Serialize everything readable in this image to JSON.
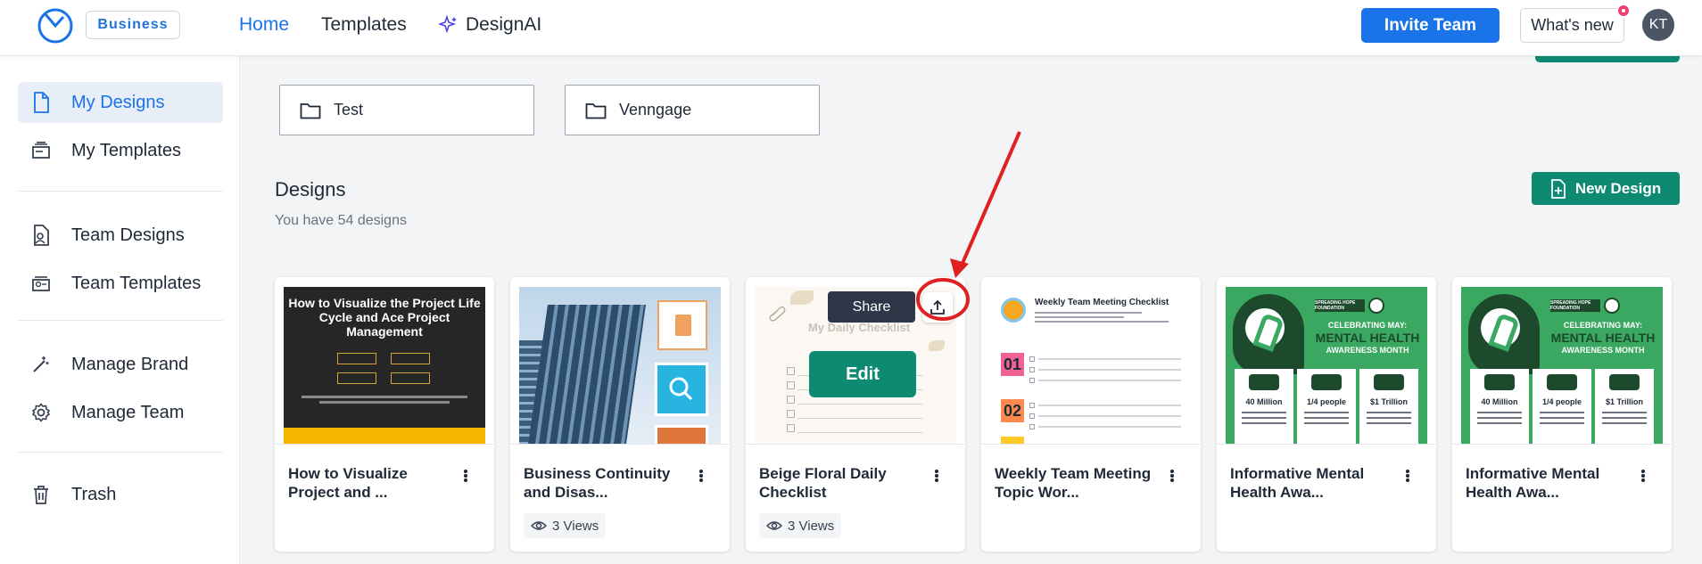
{
  "header": {
    "badge": "Business",
    "nav": [
      {
        "label": "Home"
      },
      {
        "label": "Templates"
      },
      {
        "label": "DesignAI"
      }
    ],
    "invite_label": "Invite Team",
    "whats_new_label": "What's new",
    "avatar_initials": "KT"
  },
  "sidebar": {
    "items": [
      {
        "label": "My Designs",
        "icon": "file-icon"
      },
      {
        "label": "My Templates",
        "icon": "template-icon"
      },
      {
        "label": "Team Designs",
        "icon": "team-file-icon"
      },
      {
        "label": "Team Templates",
        "icon": "team-template-icon"
      },
      {
        "label": "Manage Brand",
        "icon": "magic-wand-icon"
      },
      {
        "label": "Manage Team",
        "icon": "gear-icon"
      },
      {
        "label": "Trash",
        "icon": "trash-icon"
      }
    ]
  },
  "folders": [
    {
      "name": "Test"
    },
    {
      "name": "Venngage"
    }
  ],
  "designs": {
    "title": "Designs",
    "subtitle": "You have 54 designs",
    "new_label": "New Design"
  },
  "cards": [
    {
      "title": "How to Visualize Project and ...",
      "views": ""
    },
    {
      "title": "Business Continuity and Disas...",
      "views": "3 Views"
    },
    {
      "title": "Beige Floral Daily Checklist",
      "views": "3 Views"
    },
    {
      "title": "Weekly Team Meeting Topic Wor...",
      "views": ""
    },
    {
      "title": "Informative Mental Health Awa...",
      "views": ""
    },
    {
      "title": "Informative Mental Health Awa...",
      "views": ""
    }
  ],
  "thumbs": {
    "t1_title": "How to Visualize the Project Life Cycle and Ace Project Management",
    "t3_title": "My Daily Checklist",
    "t4_title": "Weekly Team Meeting Checklist",
    "t4_nums": [
      "01",
      "02"
    ],
    "t5": {
      "badge": "SPREADING HOPE FOUNDATION",
      "celebrating": "CELEBRATING MAY:",
      "mental_health": "MENTAL HEALTH",
      "awareness": "AWARENESS MONTH",
      "stats": [
        "40 Million",
        "1/4 people",
        "$1 Trillion"
      ]
    }
  },
  "hover": {
    "share_label": "Share",
    "edit_label": "Edit"
  },
  "colors": {
    "brand_blue": "#1a73e8",
    "brand_green": "#0e8a72",
    "annotation_red": "#e02020"
  }
}
